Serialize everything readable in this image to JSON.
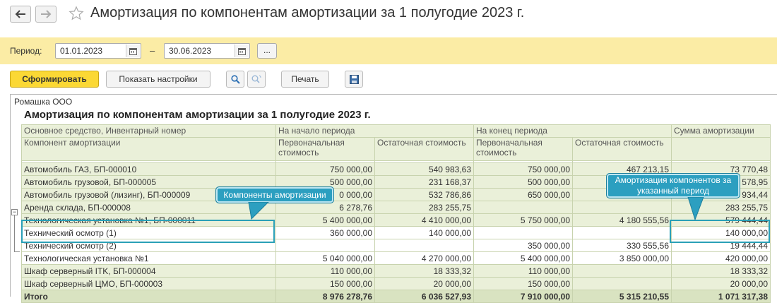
{
  "header": {
    "title": "Амортизация по компонентам амортизации за 1 полугодие 2023 г."
  },
  "period": {
    "label": "Период:",
    "from": "01.01.2023",
    "dash": "–",
    "to": "30.06.2023",
    "more": "..."
  },
  "toolbar": {
    "generate": "Сформировать",
    "settings": "Показать настройки",
    "print": "Печать"
  },
  "report": {
    "org": "Ромашка ООО",
    "title": "Амортизация по компонентам амортизации за 1 полугодие 2023 г.",
    "head1": [
      "Основное средство, Инвентарный номер",
      "На начало периода",
      "",
      "На конец периода",
      "",
      "Сумма амортизации"
    ],
    "head2": [
      "Компонент амортизации",
      "Первоначальная стоимость",
      "Остаточная стоимость",
      "Первоначальная стоимость",
      "Остаточная стоимость",
      ""
    ],
    "rows": [
      {
        "name": "Автомобиль ГАЗ, БП-000010",
        "v1": "750 000,00",
        "v2": "540 983,63",
        "v3": "750 000,00",
        "v4": "467 213,15",
        "v5": "73 770,48"
      },
      {
        "name": "Автомобиль грузовой, БП-000005",
        "v1": "500 000,00",
        "v2": "231 168,37",
        "v3": "500 000,00",
        "v4": "",
        "v5": "578,95"
      },
      {
        "name": "Автомобиль грузовой (лизинг), БП-000009",
        "v1": "0 000,00",
        "v2": "532 786,86",
        "v3": "650 000,00",
        "v4": "",
        "v5": "934,44"
      },
      {
        "name": "Аренда склада, БП-000008",
        "v1": "6 278,76",
        "v2": "283 255,75",
        "v3": "",
        "v4": "",
        "v5": "283 255,75"
      },
      {
        "name": "Технологическая установка №1, БП-000011",
        "v1": "5 400 000,00",
        "v2": "4 410 000,00",
        "v3": "5 750 000,00",
        "v4": "4 180 555,56",
        "v5": "579 444,44"
      },
      {
        "name": "Технический осмотр (1)",
        "v1": "360 000,00",
        "v2": "140 000,00",
        "v3": "",
        "v4": "",
        "v5": "140 000,00"
      },
      {
        "name": "Технический осмотр (2)",
        "v1": "",
        "v2": "",
        "v3": "350 000,00",
        "v4": "330 555,56",
        "v5": "19 444,44"
      },
      {
        "name": "Технологическая установка №1",
        "v1": "5 040 000,00",
        "v2": "4 270 000,00",
        "v3": "5 400 000,00",
        "v4": "3 850 000,00",
        "v5": "420 000,00"
      },
      {
        "name": "Шкаф серверный ITK, БП-000004",
        "v1": "110 000,00",
        "v2": "18 333,32",
        "v3": "110 000,00",
        "v4": "",
        "v5": "18 333,32"
      },
      {
        "name": "Шкаф серверный ЦМО, БП-000003",
        "v1": "150 000,00",
        "v2": "20 000,00",
        "v3": "150 000,00",
        "v4": "",
        "v5": "20 000,00"
      }
    ],
    "total": {
      "name": "Итого",
      "v1": "8 976 278,76",
      "v2": "6 036 527,93",
      "v3": "7 910 000,00",
      "v4": "5 315 210,55",
      "v5": "1 071 317,38"
    }
  },
  "callouts": {
    "components": "Компоненты амортизации",
    "period_components": "Амортизация компонентов за указанный период"
  },
  "colors": {
    "accent": "#fbd835",
    "period_bg": "#fbeca5",
    "highlight": "#2aa0b7"
  }
}
